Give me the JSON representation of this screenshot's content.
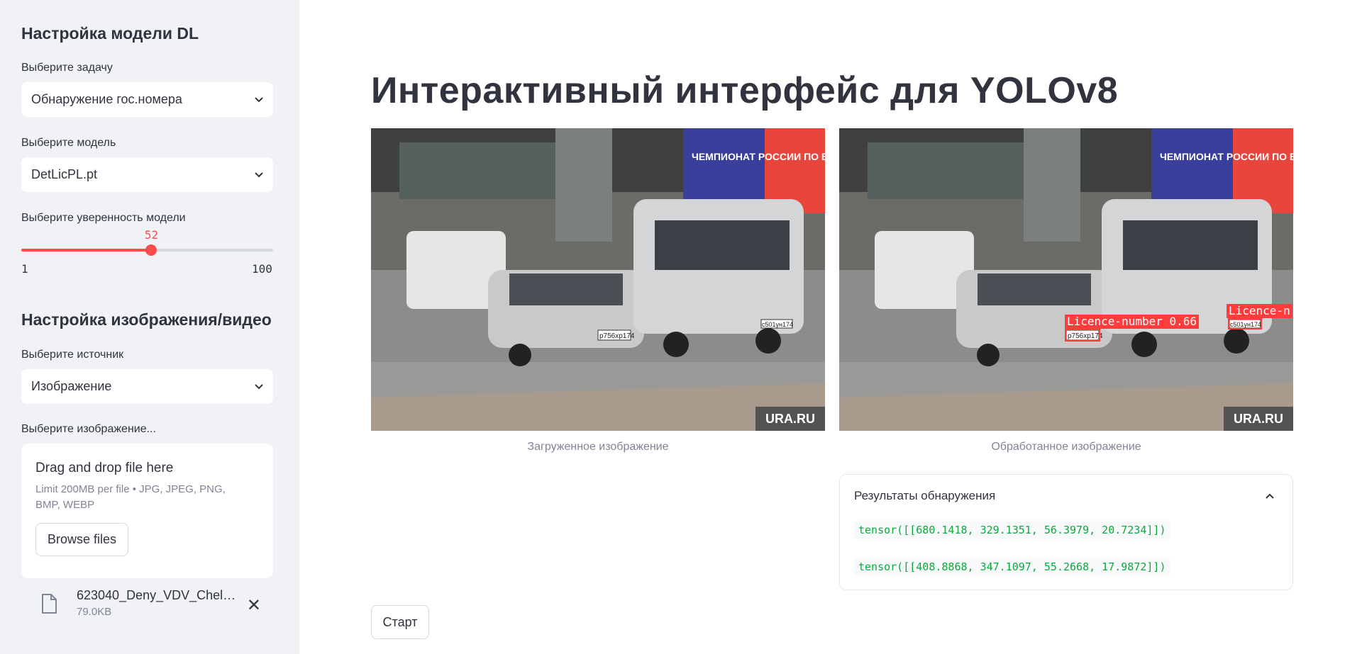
{
  "sidebar": {
    "model_section_title": "Настройка модели DL",
    "task_label": "Выберите задачу",
    "task_value": "Обнаружение гос.номера",
    "model_label": "Выберите модель",
    "model_value": "DetLicPL.pt",
    "confidence_label": "Выберите уверенность модели",
    "confidence_value": "52",
    "confidence_min": "1",
    "confidence_max": "100",
    "confidence_fraction": 0.5152,
    "image_section_title": "Настройка изображения/видео",
    "source_label": "Выберите источник",
    "source_value": "Изображение",
    "image_label": "Выберите изображение...",
    "uploader": {
      "title": "Drag and drop file here",
      "limit": "Limit 200MB per file • JPG, JPEG, PNG, BMP, WEBP",
      "browse_label": "Browse files"
    },
    "file": {
      "name": "623040_Deny_VDV_Chel…",
      "size": "79.0KB"
    }
  },
  "main": {
    "title": "Интерактивный интерфейс для YOLOv8",
    "uploaded_caption": "Загруженное изображение",
    "processed_caption": "Обработанное изображение",
    "watermark": "URA.RU",
    "billboard": "ЧЕМПИОНАТ РОССИИ ПО БОКСУ",
    "plate_left": "р756хр174",
    "plate_right": "с501ун174",
    "detection_label_1": "Licence-number 0.66",
    "detection_label_2": "Licence-n",
    "results_title": "Результаты обнаружения",
    "results": [
      "tensor([[680.1418, 329.1351, 56.3979, 20.7234]])",
      "tensor([[408.8868, 347.1097, 55.2668, 17.9872]])"
    ],
    "start_label": "Старт"
  },
  "colors": {
    "accent": "#ff4b4b",
    "sidebar_bg": "#f0f2f6",
    "code_green": "#09ab3b"
  }
}
